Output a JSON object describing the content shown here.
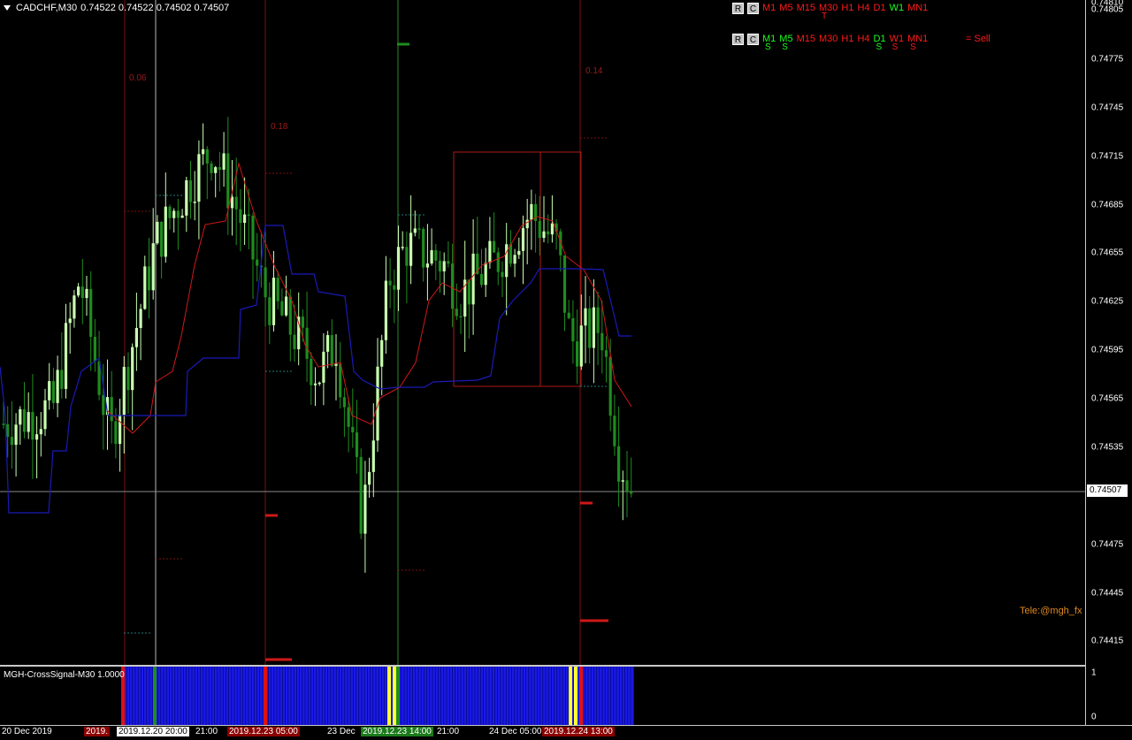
{
  "header": {
    "symbol_title": "CADCHF,M30",
    "ohlc": "0.74522 0.74522 0.74502 0.74507"
  },
  "price_axis": {
    "labels": [
      "0.74810",
      "0.74805",
      "0.74775",
      "0.74745",
      "0.74715",
      "0.74685",
      "0.74655",
      "0.74625",
      "0.74595",
      "0.74565",
      "0.74535",
      "0.74505",
      "0.74475",
      "0.74445",
      "0.74415"
    ],
    "current_price": "0.74507"
  },
  "tf_panel": {
    "row1": {
      "buttons": [
        "R",
        "C"
      ],
      "frames": [
        {
          "label": "M1",
          "color": "#ff1a1a",
          "sig": ""
        },
        {
          "label": "M5",
          "color": "#ff1a1a",
          "sig": ""
        },
        {
          "label": "M15",
          "color": "#ff1a1a",
          "sig": ""
        },
        {
          "label": "M30",
          "color": "#ff1a1a",
          "sig": "T"
        },
        {
          "label": "H1",
          "color": "#ff1a1a",
          "sig": ""
        },
        {
          "label": "H4",
          "color": "#ff1a1a",
          "sig": ""
        },
        {
          "label": "D1",
          "color": "#ff1a1a",
          "sig": ""
        },
        {
          "label": "W1",
          "color": "#1aff1a",
          "sig": ""
        },
        {
          "label": "MN1",
          "color": "#ff1a1a",
          "sig": ""
        }
      ]
    },
    "row2": {
      "buttons": [
        "R",
        "C"
      ],
      "frames": [
        {
          "label": "M1",
          "color": "#1aff1a",
          "sig": "S"
        },
        {
          "label": "M5",
          "color": "#1aff1a",
          "sig": "S"
        },
        {
          "label": "M15",
          "color": "#ff1a1a",
          "sig": ""
        },
        {
          "label": "M30",
          "color": "#ff1a1a",
          "sig": ""
        },
        {
          "label": "H1",
          "color": "#ff1a1a",
          "sig": ""
        },
        {
          "label": "H4",
          "color": "#ff1a1a",
          "sig": ""
        },
        {
          "label": "D1",
          "color": "#1aff1a",
          "sig": "S"
        },
        {
          "label": "W1",
          "color": "#ff1a1a",
          "sig": "S"
        },
        {
          "label": "MN1",
          "color": "#ff1a1a",
          "sig": "S"
        }
      ],
      "result": "= Sell"
    }
  },
  "levels": [
    "0.06",
    "0.18",
    "0.14"
  ],
  "telegram": "Tele:@mgh_fx",
  "sub_window": {
    "title": "MGH-CrossSignal-M30 1.0000",
    "axis": [
      "1",
      "0"
    ]
  },
  "time_axis": [
    {
      "text": "20 Dec 2019",
      "bg": "",
      "fg": "#ffffff"
    },
    {
      "text": "2019.",
      "bg": "#8b0000",
      "fg": "#ffffff"
    },
    {
      "text": "2019.12.20 20:00",
      "bg": "#ffffff",
      "fg": "#000000"
    },
    {
      "text": "21:00",
      "bg": "",
      "fg": "#ffffff"
    },
    {
      "text": "2019.12.23 05:00",
      "bg": "#8b0000",
      "fg": "#ffffff"
    },
    {
      "text": "23 Dec",
      "bg": "",
      "fg": "#ffffff"
    },
    {
      "text": "2019.12.23 14:00",
      "bg": "#1a7a1a",
      "fg": "#ffffff"
    },
    {
      "text": "21:00",
      "bg": "",
      "fg": "#ffffff"
    },
    {
      "text": "24 Dec 05:00",
      "bg": "",
      "fg": "#ffffff"
    },
    {
      "text": "2019.12.24 13:00",
      "bg": "#8b0000",
      "fg": "#ffffff"
    }
  ],
  "colors": {
    "bull": "#c8ffb0",
    "bear": "#1e8c1e",
    "red_line": "#d01818",
    "blue_line": "#1a1ab8",
    "bar_blue": "#1a1ae6"
  }
}
